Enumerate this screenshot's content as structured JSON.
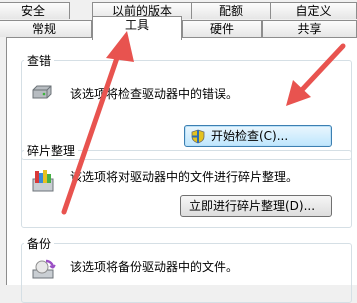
{
  "tabs_row1": [
    "安全",
    "以前的版本",
    "配额",
    "自定义"
  ],
  "tabs_row2": [
    "常规",
    "工具",
    "硬件",
    "共享"
  ],
  "sections": {
    "error_check": {
      "title": "查错",
      "description": "该选项将检查驱动器中的错误。",
      "button": "开始检查(C)..."
    },
    "defrag": {
      "title": "碎片整理",
      "description": "该选项将对驱动器中的文件进行碎片整理。",
      "button": "立即进行碎片整理(D)..."
    },
    "backup": {
      "title": "备份",
      "description": "该选项将备份驱动器中的文件。"
    }
  },
  "colors": {
    "annotation_arrow": "#e8534f"
  },
  "icons": {
    "error_check": "drive-check-icon",
    "defrag": "defrag-icon",
    "backup": "backup-icon",
    "check_button": "shield-icon"
  }
}
